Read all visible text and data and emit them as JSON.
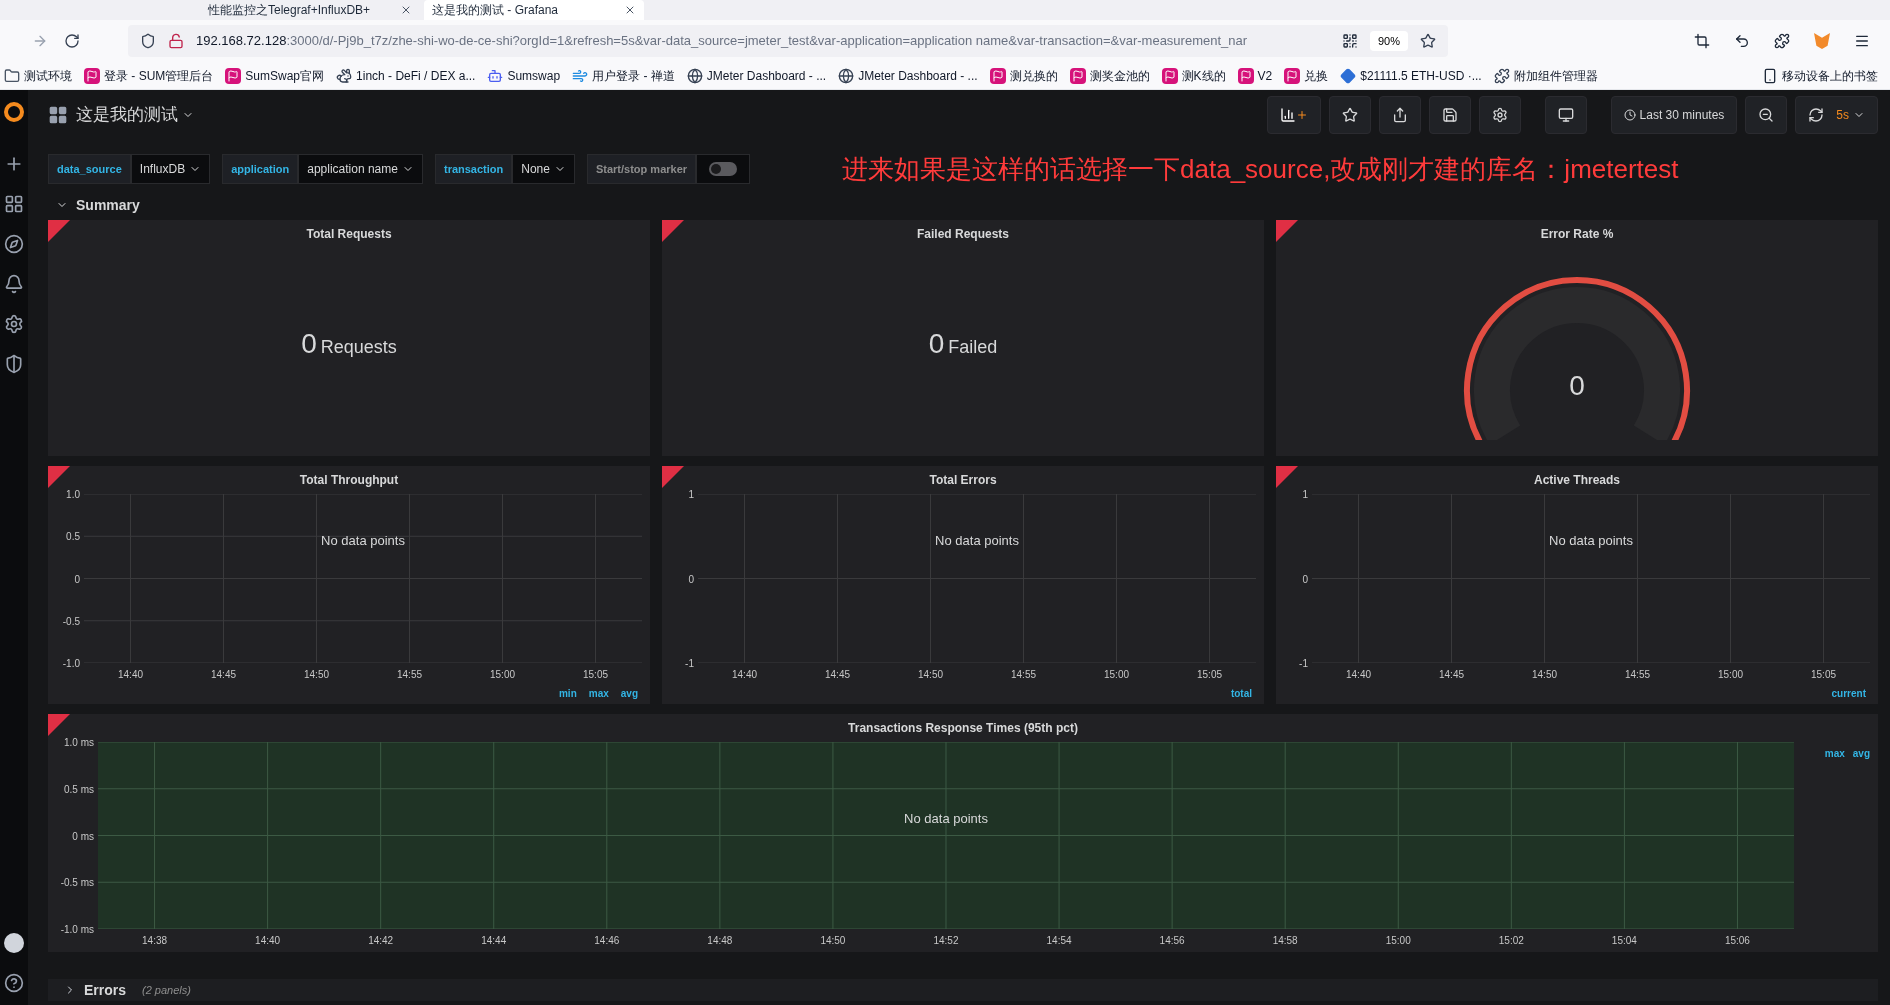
{
  "browser": {
    "tabs": [
      {
        "title": "性能监控之Telegraf+InfluxDB+",
        "selected": false
      },
      {
        "title": "这是我的测试 - Grafana",
        "selected": true
      }
    ],
    "url_host": "192.168.72.128",
    "url_rest": ":3000/d/-Pj9b_t7z/zhe-shi-wo-de-ce-shi?orgId=1&refresh=5s&var-data_source=jmeter_test&var-application=application name&var-transaction=&var-measurement_nar",
    "zoom": "90%",
    "bookmarks": [
      {
        "title": "测试环境",
        "kind": "folder"
      },
      {
        "title": "登录 - SUM管理后台",
        "kind": "flag"
      },
      {
        "title": "SumSwap官网",
        "kind": "flag"
      },
      {
        "title": "1inch - DeFi / DEX a...",
        "kind": "horse"
      },
      {
        "title": "Sumswap",
        "kind": "bot"
      },
      {
        "title": "用户登录 - 禅道",
        "kind": "swirl"
      },
      {
        "title": "JMeter Dashboard - ...",
        "kind": "globe"
      },
      {
        "title": "JMeter Dashboard - ...",
        "kind": "globe"
      },
      {
        "title": "测兑换的",
        "kind": "flag"
      },
      {
        "title": "测奖金池的",
        "kind": "flag"
      },
      {
        "title": "测K线的",
        "kind": "flag"
      },
      {
        "title": "V2",
        "kind": "flag"
      },
      {
        "title": "兑换",
        "kind": "flag"
      },
      {
        "title": "$21111.5 ETH-USD ·...",
        "kind": "diamond"
      },
      {
        "title": "附加组件管理器",
        "kind": "puzzle"
      }
    ],
    "mobile_bookmarks": "移动设备上的书签"
  },
  "dashboard": {
    "title": "这是我的测试",
    "time_range": "Last 30 minutes",
    "refresh": "5s",
    "variables": [
      {
        "label": "data_source",
        "value": "InfluxDB",
        "kind": "dropdown"
      },
      {
        "label": "application",
        "value": "application name",
        "kind": "dropdown"
      },
      {
        "label": "transaction",
        "value": "None",
        "kind": "dropdown"
      },
      {
        "label": "Start/stop marker",
        "kind": "switch",
        "on": false
      }
    ],
    "annotation": "进来如果是这样的话选择一下data_source,改成刚才建的库名：jmetertest",
    "summary_row": {
      "title": "Summary",
      "expanded": true
    },
    "panels": [
      {
        "kind": "stat",
        "title": "Total Requests",
        "error": true,
        "value": "0",
        "unit": "Requests"
      },
      {
        "kind": "stat",
        "title": "Failed Requests",
        "error": true,
        "value": "0",
        "unit": "Failed"
      },
      {
        "kind": "gauge",
        "title": "Error Rate %",
        "error": true,
        "value": "0"
      },
      {
        "kind": "graph",
        "title": "Total Throughput",
        "error": true,
        "message": "No data points",
        "y_ticks": [
          "1.0",
          "0.5",
          "0",
          "-0.5",
          "-1.0"
        ],
        "x_ticks": [
          "14:40",
          "14:45",
          "14:50",
          "14:55",
          "15:00",
          "15:05"
        ],
        "legend": [
          "min",
          "max",
          "avg"
        ]
      },
      {
        "kind": "graph",
        "title": "Total Errors",
        "error": true,
        "message": "No data points",
        "y_ticks": [
          "1",
          "0",
          "-1"
        ],
        "x_ticks": [
          "14:40",
          "14:45",
          "14:50",
          "14:55",
          "15:00",
          "15:05"
        ],
        "legend": [
          "total"
        ]
      },
      {
        "kind": "graph",
        "title": "Active Threads",
        "error": true,
        "message": "No data points",
        "y_ticks": [
          "1",
          "0",
          "-1"
        ],
        "x_ticks": [
          "14:40",
          "14:45",
          "14:50",
          "14:55",
          "15:00",
          "15:05"
        ],
        "legend": [
          "current"
        ]
      },
      {
        "kind": "wide_graph",
        "title": "Transactions Response Times (95th pct)",
        "error": true,
        "message": "No data points",
        "y_ticks": [
          "1.0 ms",
          "0.5 ms",
          "0 ms",
          "-0.5 ms",
          "-1.0 ms"
        ],
        "x_ticks": [
          "14:38",
          "14:40",
          "14:42",
          "14:44",
          "14:46",
          "14:48",
          "14:50",
          "14:52",
          "14:54",
          "14:56",
          "14:58",
          "15:00",
          "15:02",
          "15:04",
          "15:06"
        ],
        "legend": [
          "max",
          "avg"
        ]
      }
    ],
    "errors_row": {
      "title": "Errors",
      "count": "(2 panels)",
      "expanded": false
    }
  }
}
